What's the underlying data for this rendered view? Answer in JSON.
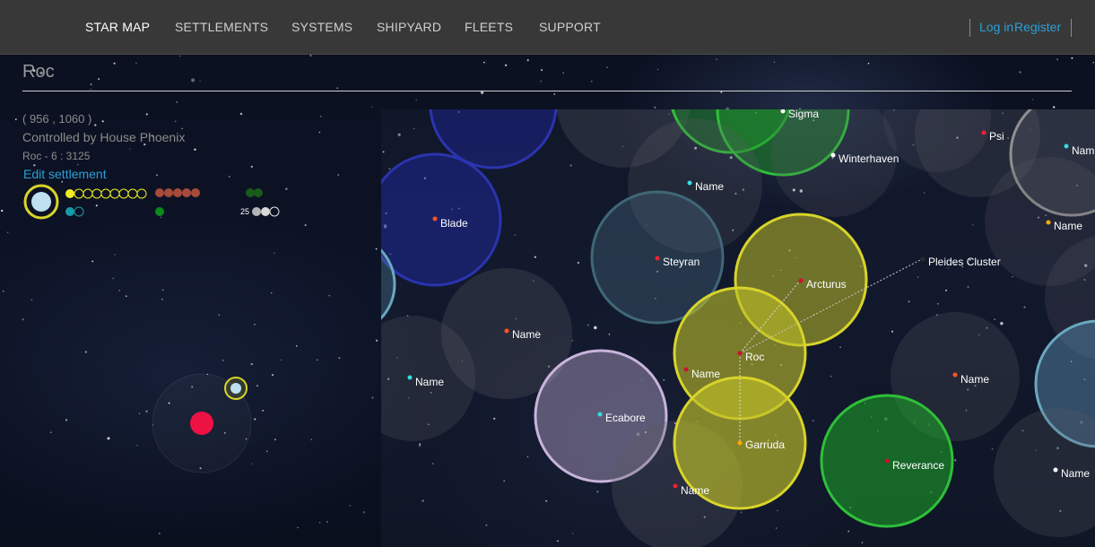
{
  "nav": {
    "items": [
      {
        "label": "STAR MAP",
        "active": true
      },
      {
        "label": "SETTLEMENTS",
        "active": false
      },
      {
        "label": "SYSTEMS",
        "active": false
      },
      {
        "label": "SHIPYARD",
        "active": false
      },
      {
        "label": "FLEETS",
        "active": false
      },
      {
        "label": "SUPPORT",
        "active": false
      }
    ],
    "login_label": "Log in",
    "register_label": "Register"
  },
  "settlement": {
    "name": "Roc",
    "coords": "( 956 , 1060 )",
    "controller": "Controlled by House Phoenix",
    "code_line": "Roc - 6 : 3125",
    "edit_label": "Edit settlement",
    "ship_count": "25"
  },
  "colors": {
    "link": "#2a9fd6",
    "yellow_zone": "#d8d42a",
    "green_zone": "#2fc03a",
    "blue_zone": "#2a34b0",
    "teal_zone": "#6aa8c0",
    "lavender_zone": "#c8b4dc",
    "red_star": "#ee1144"
  },
  "starmap": {
    "systems": [
      {
        "label": "Sigma",
        "star_color": "#ffffff"
      },
      {
        "label": "Psi",
        "star_color": "#ee2233"
      },
      {
        "label": "Nam",
        "star_color": "#33dddd"
      },
      {
        "label": "Winterhaven",
        "star_color": "#ffffff"
      },
      {
        "label": "Name",
        "star_color": "#33dddd"
      },
      {
        "label": "Blade",
        "star_color": "#ff5522"
      },
      {
        "label": "Name",
        "star_color": "#ffaa00"
      },
      {
        "label": "Steyran",
        "star_color": "#ee2233"
      },
      {
        "label": "Pleides Cluster",
        "star_color": "#2a2a2a"
      },
      {
        "label": "Arcturus",
        "star_color": "#cc1133"
      },
      {
        "label": "Name",
        "star_color": "#ff5522"
      },
      {
        "label": "Roc",
        "star_color": "#cc1133"
      },
      {
        "label": "Name",
        "star_color": "#cc1133"
      },
      {
        "label": "Name",
        "star_color": "#33dddd"
      },
      {
        "label": "Name",
        "star_color": "#ff5522"
      },
      {
        "label": "Ecabore",
        "star_color": "#33dddd"
      },
      {
        "label": "Garruda",
        "star_color": "#ffaa00"
      },
      {
        "label": "Reverance",
        "star_color": "#cc1133"
      },
      {
        "label": "Name",
        "star_color": "#ee2233"
      },
      {
        "label": "Name",
        "star_color": "#ffffff"
      }
    ]
  }
}
